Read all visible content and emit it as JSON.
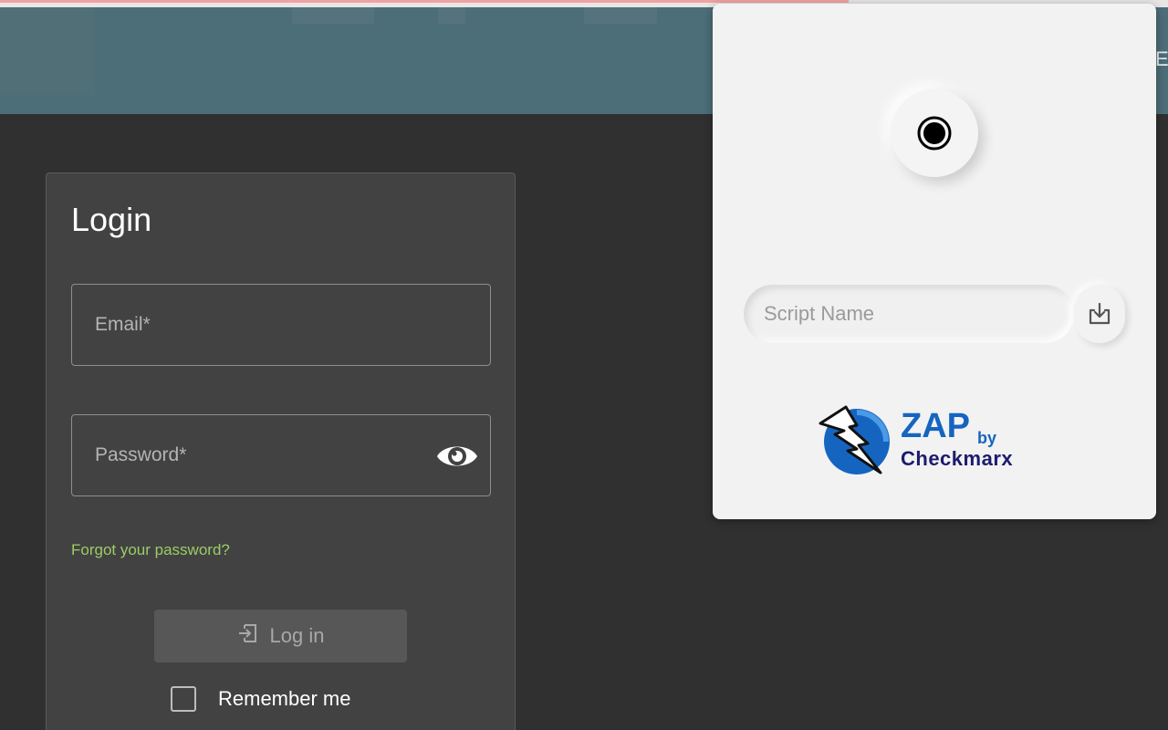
{
  "header": {
    "cut_text": "E"
  },
  "login": {
    "title": "Login",
    "email_placeholder": "Email*",
    "password_placeholder": "Password*",
    "forgot_link": "Forgot your password?",
    "login_button": "Log in",
    "remember_label": "Remember me"
  },
  "popup": {
    "script_name_placeholder": "Script Name",
    "logo": {
      "name": "ZAP",
      "by": "by",
      "company": "Checkmarx"
    }
  },
  "colors": {
    "header_bg": "#4c6e79",
    "page_bg": "#303030",
    "card_bg": "#424242",
    "link_green": "#9ccc65",
    "zap_blue": "#1565c0"
  },
  "icons": [
    "eye-icon",
    "login-icon",
    "record-icon",
    "download-icon",
    "zap-lightning-icon"
  ]
}
